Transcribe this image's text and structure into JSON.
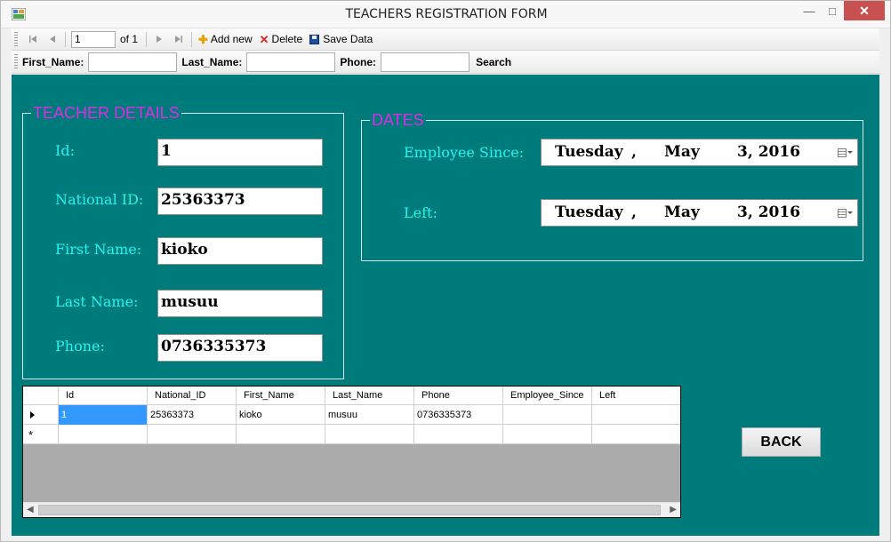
{
  "window": {
    "title": "TEACHERS REGISTRATION FORM",
    "minimize_glyph": "—",
    "maximize_glyph": "□",
    "close_glyph": "✕"
  },
  "navigator": {
    "position": "1",
    "of_label": "of 1",
    "add_new_label": "Add new",
    "delete_label": "Delete",
    "save_label": "Save Data"
  },
  "search_bar": {
    "first_name_label": "First_Name:",
    "first_name_value": "",
    "last_name_label": "Last_Name:",
    "last_name_value": "",
    "phone_label": "Phone:",
    "phone_value": "",
    "search_label": "Search"
  },
  "teacher_details": {
    "title": "TEACHER DETAILS",
    "fields": [
      {
        "label": "Id:",
        "value": "1"
      },
      {
        "label": "National ID:",
        "value": "25363373"
      },
      {
        "label": "First Name:",
        "value": "kioko"
      },
      {
        "label": "Last Name:",
        "value": "musuu"
      },
      {
        "label": "Phone:",
        "value": "0736335373"
      }
    ]
  },
  "dates": {
    "title": "DATES",
    "employee_since": {
      "label": "Employee Since:",
      "day": "Tuesday",
      "comma": ",",
      "month": "May",
      "date": "3, 2016"
    },
    "left": {
      "label": "Left:",
      "day": "Tuesday",
      "comma": ",",
      "month": "May",
      "date": "3, 2016"
    }
  },
  "grid": {
    "columns": [
      "Id",
      "National_ID",
      "First_Name",
      "Last_Name",
      "Phone",
      "Employee_Since",
      "Left"
    ],
    "rows": [
      [
        "1",
        "25363373",
        "kioko",
        "musuu",
        "0736335373",
        "",
        ""
      ]
    ],
    "new_row_glyph": "*"
  },
  "back_button": {
    "label": "BACK"
  },
  "colors": {
    "client_bg": "#007b7b",
    "group_title": "#e02be6",
    "field_label": "#22f5ef",
    "selection": "#3399ff"
  }
}
